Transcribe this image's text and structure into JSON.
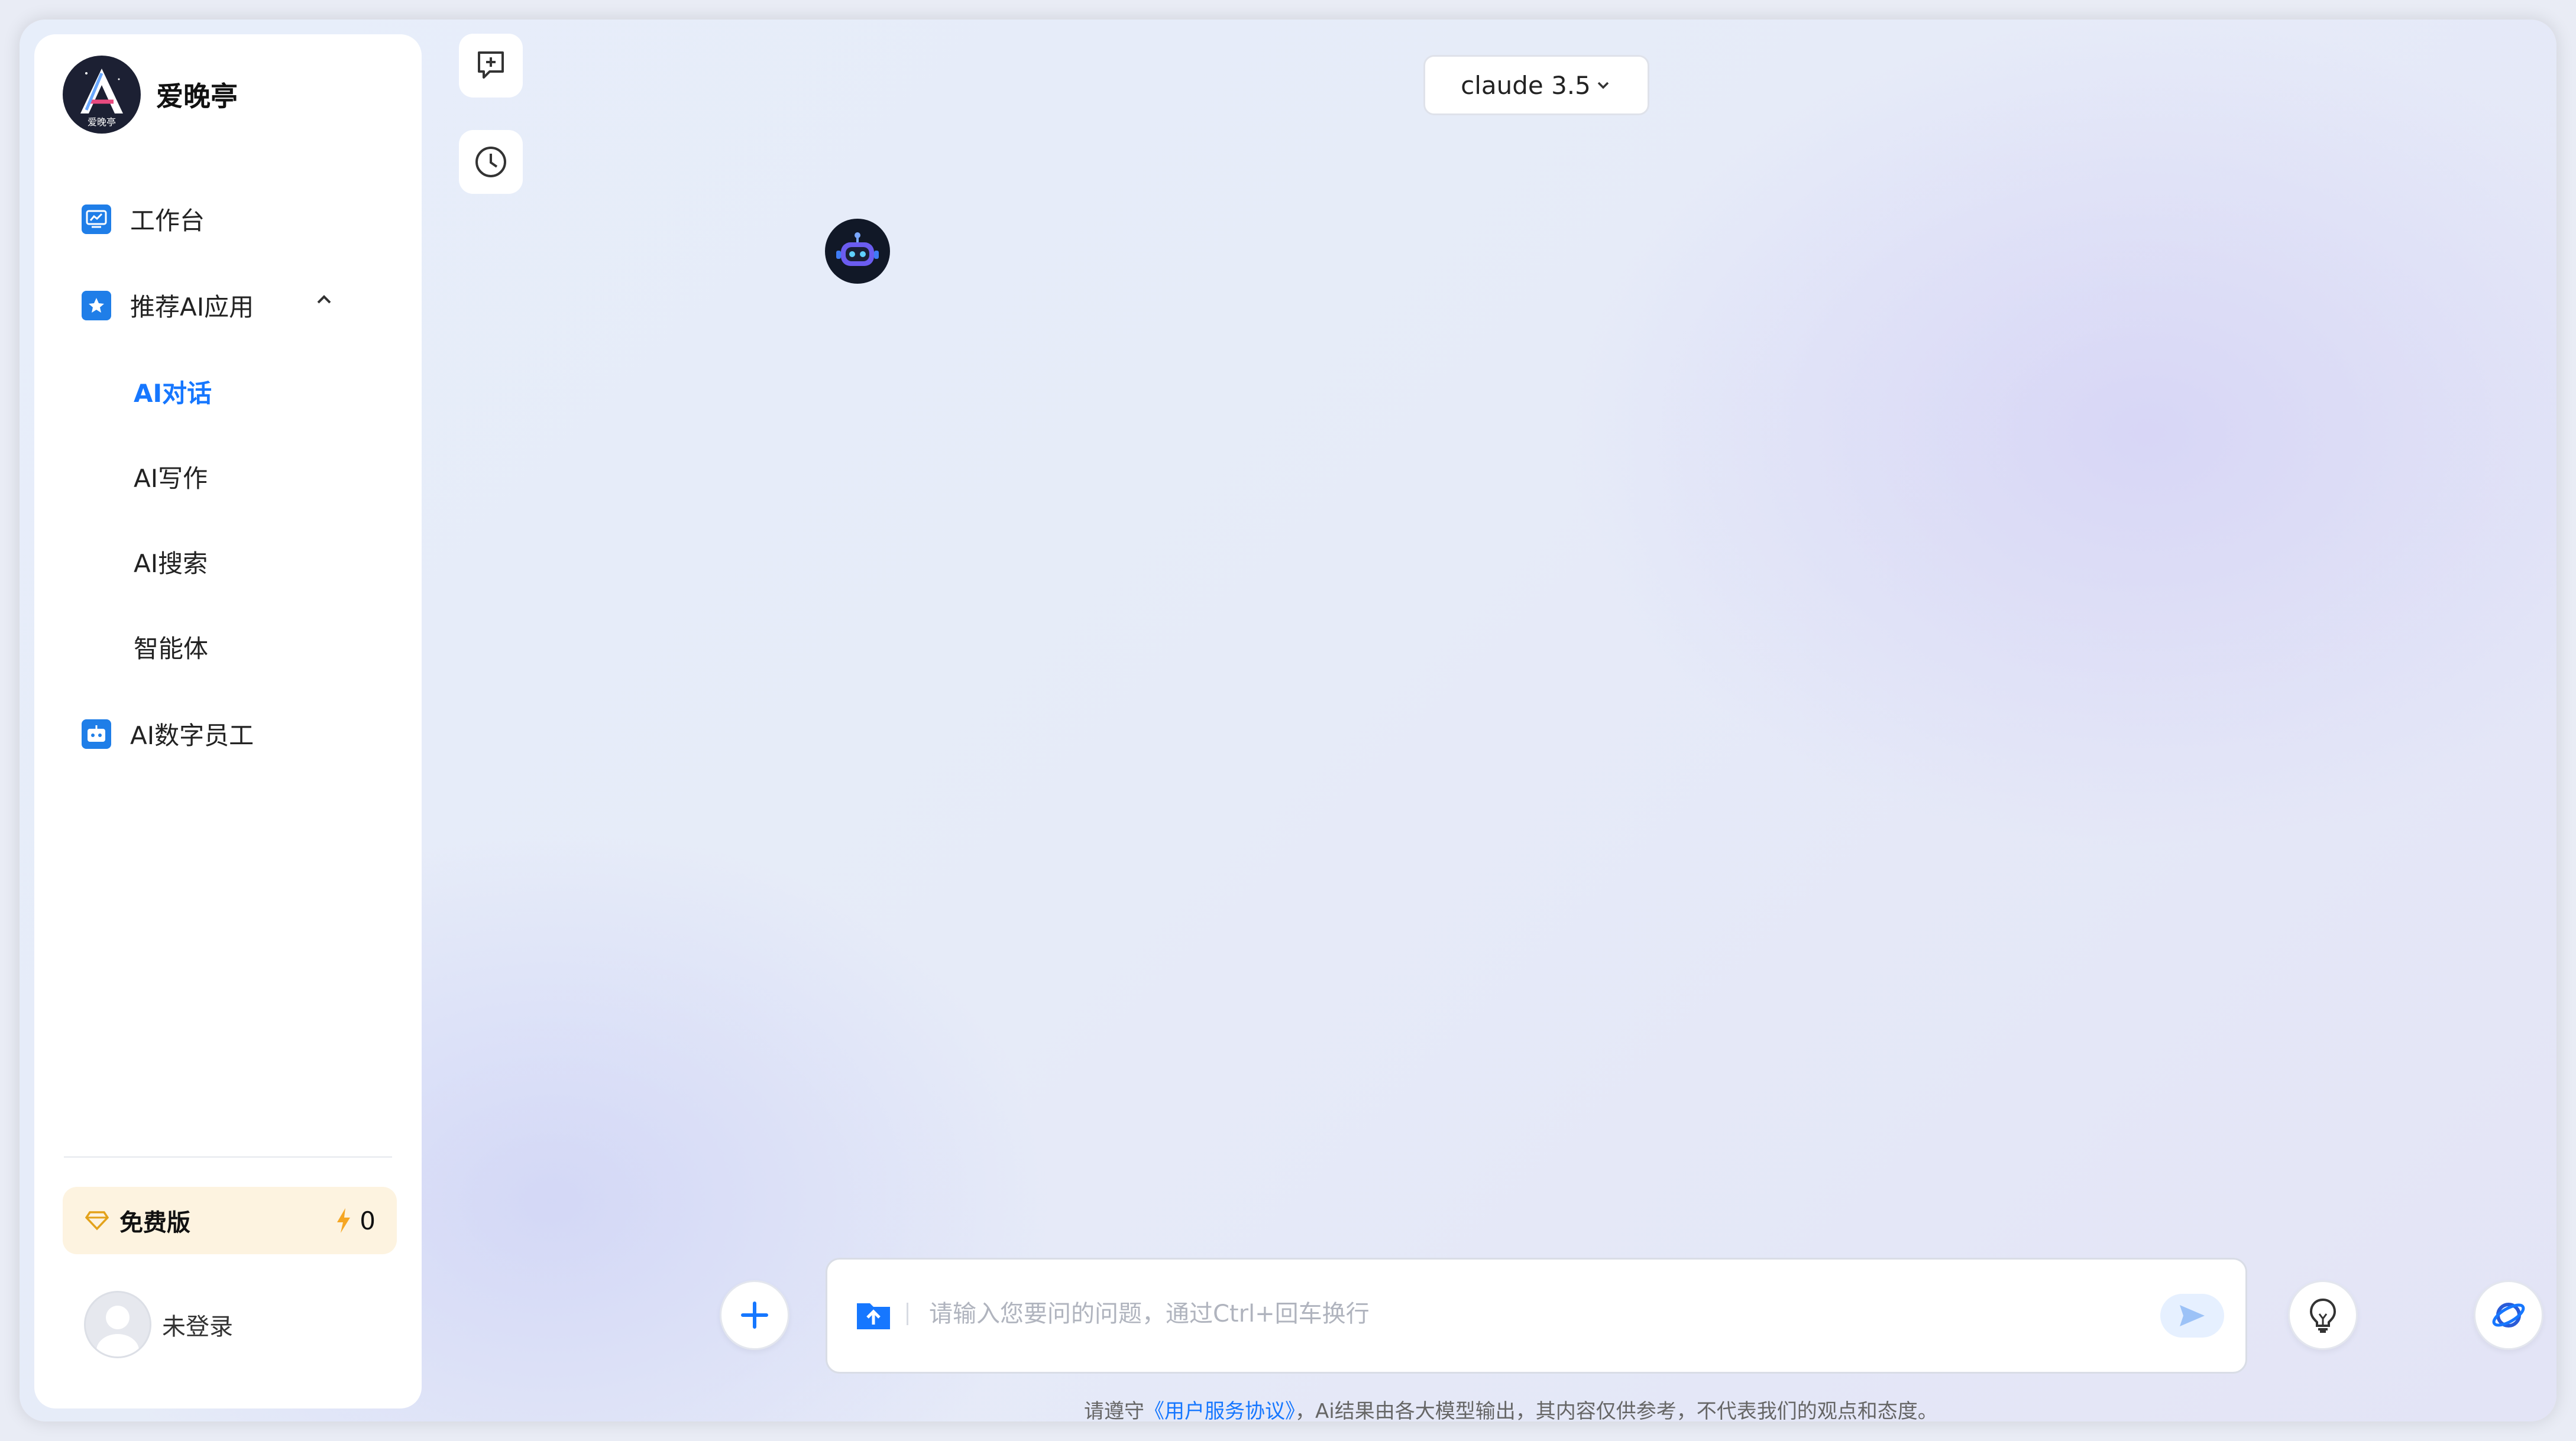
{
  "brand": {
    "name": "爱晚亭",
    "logo_text": "爱晚亭"
  },
  "sidebar": {
    "workbench_label": "工作台",
    "recommended": {
      "label": "推荐AI应用",
      "items": [
        {
          "label": "AI对话",
          "active": true
        },
        {
          "label": "AI写作",
          "active": false
        },
        {
          "label": "AI搜索",
          "active": false
        },
        {
          "label": "智能体",
          "active": false
        }
      ]
    },
    "digital_employee_label": "AI数字员工",
    "plan": {
      "label": "免费版",
      "credits": "0"
    },
    "user": {
      "label": "未登录"
    }
  },
  "toolbar": {
    "new_chat_icon": "new-chat-icon",
    "history_icon": "clock-icon"
  },
  "model_select": {
    "value": "claude 3.5"
  },
  "composer": {
    "placeholder": "请输入您要问的问题，通过Ctrl+回车换行",
    "value": ""
  },
  "footer": {
    "prefix": "请遵守",
    "link": "《用户服务协议》",
    "suffix": "，Ai结果由各大模型输出，其内容仅供参考，不代表我们的观点和态度。"
  },
  "colors": {
    "accent": "#1677ff",
    "plan_bg": "#fdf3e0",
    "icon_blue": "#1f7ee8"
  }
}
